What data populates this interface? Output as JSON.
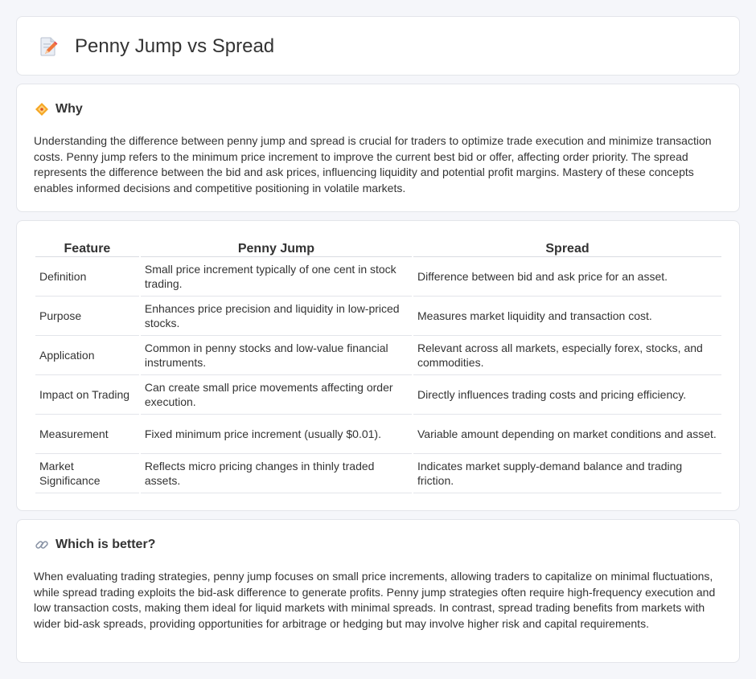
{
  "page": {
    "title": "Penny Jump vs Spread",
    "title_icon": "pencil-document-icon"
  },
  "why": {
    "heading": "Why",
    "icon": "diamond-sign-icon",
    "text": "Understanding the difference between penny jump and spread is crucial for traders to optimize trade execution and minimize transaction costs. Penny jump refers to the minimum price increment to improve the current best bid or offer, affecting order priority. The spread represents the difference between the bid and ask prices, influencing liquidity and potential profit margins. Mastery of these concepts enables informed decisions and competitive positioning in volatile markets."
  },
  "comparison": {
    "headers": [
      "Feature",
      "Penny Jump",
      "Spread"
    ],
    "rows": [
      [
        "Definition",
        "Small price increment typically of one cent in stock trading.",
        "Difference between bid and ask price for an asset."
      ],
      [
        "Purpose",
        "Enhances price precision and liquidity in low-priced stocks.",
        "Measures market liquidity and transaction cost."
      ],
      [
        "Application",
        "Common in penny stocks and low-value financial instruments.",
        "Relevant across all markets, especially forex, stocks, and commodities."
      ],
      [
        "Impact on Trading",
        "Can create small price movements affecting order execution.",
        "Directly influences trading costs and pricing efficiency."
      ],
      [
        "Measurement",
        "Fixed minimum price increment (usually $0.01).",
        "Variable amount depending on market conditions and asset."
      ],
      [
        "Market Significance",
        "Reflects micro pricing changes in thinly traded assets.",
        "Indicates market supply-demand balance and trading friction."
      ]
    ]
  },
  "better": {
    "heading": "Which is better?",
    "icon": "link-icon",
    "text": "When evaluating trading strategies, penny jump focuses on small price increments, allowing traders to capitalize on minimal fluctuations, while spread trading exploits the bid-ask difference to generate profits. Penny jump strategies often require high-frequency execution and low transaction costs, making them ideal for liquid markets with minimal spreads. In contrast, spread trading benefits from markets with wider bid-ask spreads, providing opportunities for arbitrage or hedging but may involve higher risk and capital requirements."
  }
}
